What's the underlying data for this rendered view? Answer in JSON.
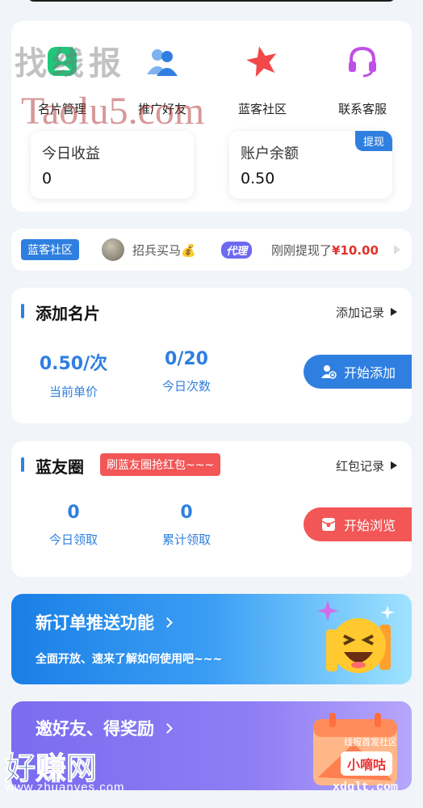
{
  "nav": {
    "items": [
      {
        "label": "名片管理",
        "icon": "contact-card-icon"
      },
      {
        "label": "推广好友",
        "icon": "users-icon"
      },
      {
        "label": "蓝客社区",
        "icon": "star-icon"
      },
      {
        "label": "联系客服",
        "icon": "headset-icon"
      }
    ]
  },
  "stats": {
    "today_label": "今日收益",
    "today_value": "0",
    "balance_label": "账户余额",
    "balance_value": "0.50",
    "withdraw_label": "提现"
  },
  "ticker": {
    "badge": "蓝客社区",
    "name": "招兵买马💰",
    "agent_tag": "代理",
    "text": "刚刚提现了",
    "amount": "¥10.00"
  },
  "add_card": {
    "title": "添加名片",
    "record_link": "添加记录",
    "price_value": "0.50/次",
    "price_label": "当前单价",
    "count_value": "0/20",
    "count_label": "今日次数",
    "button": "开始添加"
  },
  "friend_circle": {
    "title": "蓝友圈",
    "promo_tag": "刷蓝友圈抢红包~~~",
    "record_link": "红包记录",
    "today_value": "0",
    "today_label": "今日领取",
    "total_value": "0",
    "total_label": "累计领取",
    "button": "开始浏览"
  },
  "banner_orders": {
    "title": "新订单推送功能",
    "subtitle": "全面开放、速来了解如何使用吧~~~"
  },
  "banner_invite": {
    "title": "邀好友、得奖励"
  },
  "watermarks": {
    "top_left": "找线报",
    "taolu": "Taolu5.com",
    "bottom_left": "好赚网",
    "bottom_url": "www.zhuanyes.com",
    "bottom_right_top": "线报首发社区",
    "bottom_right_brand": "小嘀咕",
    "bottom_right_url": "xdglt.com"
  },
  "colors": {
    "accent": "#2f7fe0",
    "promo_red": "#f25656",
    "amount_red": "#e2312b"
  }
}
